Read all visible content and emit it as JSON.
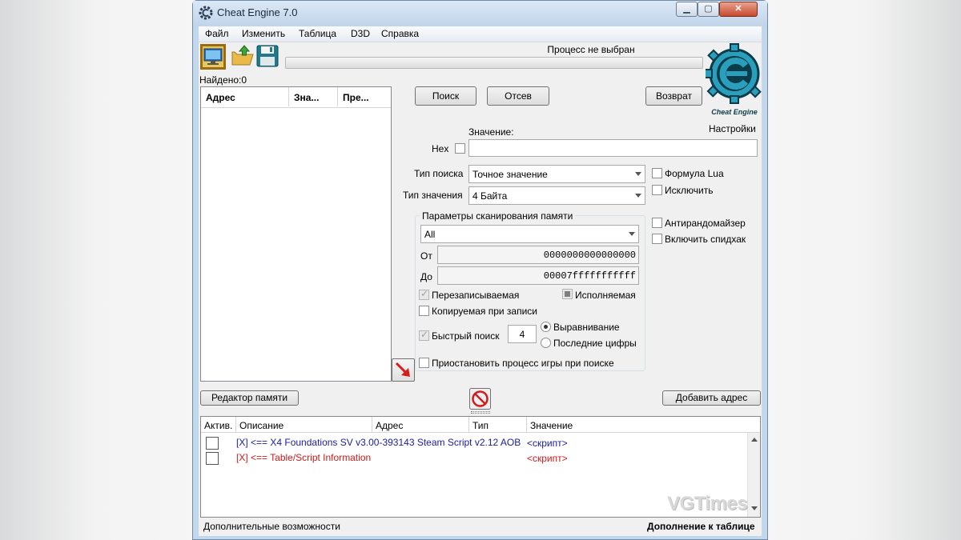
{
  "window": {
    "title": "Cheat Engine 7.0",
    "minimize_glyph": "▁",
    "maximize_glyph": "▢",
    "close_glyph": "✕"
  },
  "menu": [
    "Файл",
    "Изменить",
    "Таблица",
    "D3D",
    "Справка"
  ],
  "toolbar": {
    "process_icon": "monitor-icon",
    "open_icon": "folder-open-icon",
    "save_icon": "floppy-save-icon"
  },
  "process": {
    "label": "Процесс не выбран",
    "progress": 0
  },
  "found": "Найдено:0",
  "found_list": {
    "columns": [
      "Адрес",
      "Зна...",
      "Пре..."
    ]
  },
  "buttons": {
    "search": "Поиск",
    "filter": "Отсев",
    "undo": "Возврат",
    "memory_view": "Редактор памяти",
    "add_address": "Добавить адрес"
  },
  "logo": {
    "text": "Cheat Engine",
    "settings": "Настройки",
    "color": "#2a9fbc"
  },
  "value_section": {
    "value_label": "Значение:",
    "hex_label": "Hex",
    "scan_type_label": "Тип поиска",
    "scan_type": "Точное значение",
    "value_type_label": "Тип значения",
    "value_type": "4 Байта"
  },
  "options": {
    "lua_formula": "Формула Lua",
    "not": "Исключить",
    "unrandomizer": "Антирандомайзер",
    "speedhack": "Включить спидхак"
  },
  "memory_scan": {
    "title": "Параметры сканирования памяти",
    "region": "All",
    "from_label": "От",
    "from_value": "0000000000000000",
    "to_label": "До",
    "to_value": "00007fffffffffff",
    "writable": "Перезаписываемая",
    "executable": "Исполняемая",
    "copy_on_write": "Копируемая при записи",
    "fast_scan": "Быстрый поиск",
    "fast_scan_value": "4",
    "alignment": "Выравнивание",
    "last_digits": "Последние цифры",
    "pause_game": "Приостановить процесс игры при поиске"
  },
  "cheat_table": {
    "columns": [
      "Актив.",
      "Описание",
      "Адрес",
      "Тип",
      "Значение"
    ],
    "rows": [
      {
        "description": "[X] <== X4 Foundations SV v3.00-393143 Steam Script v2.12 AOB",
        "value": "<скрипт>",
        "color": "#1a1aa6"
      },
      {
        "description": "[X] <== Table/Script Information",
        "value": "<скрипт>",
        "color": "#cc1a1a"
      }
    ]
  },
  "watermark": "VGTimes",
  "status": {
    "left": "Дополнительные возможности",
    "right": "Дополнение к таблице"
  }
}
